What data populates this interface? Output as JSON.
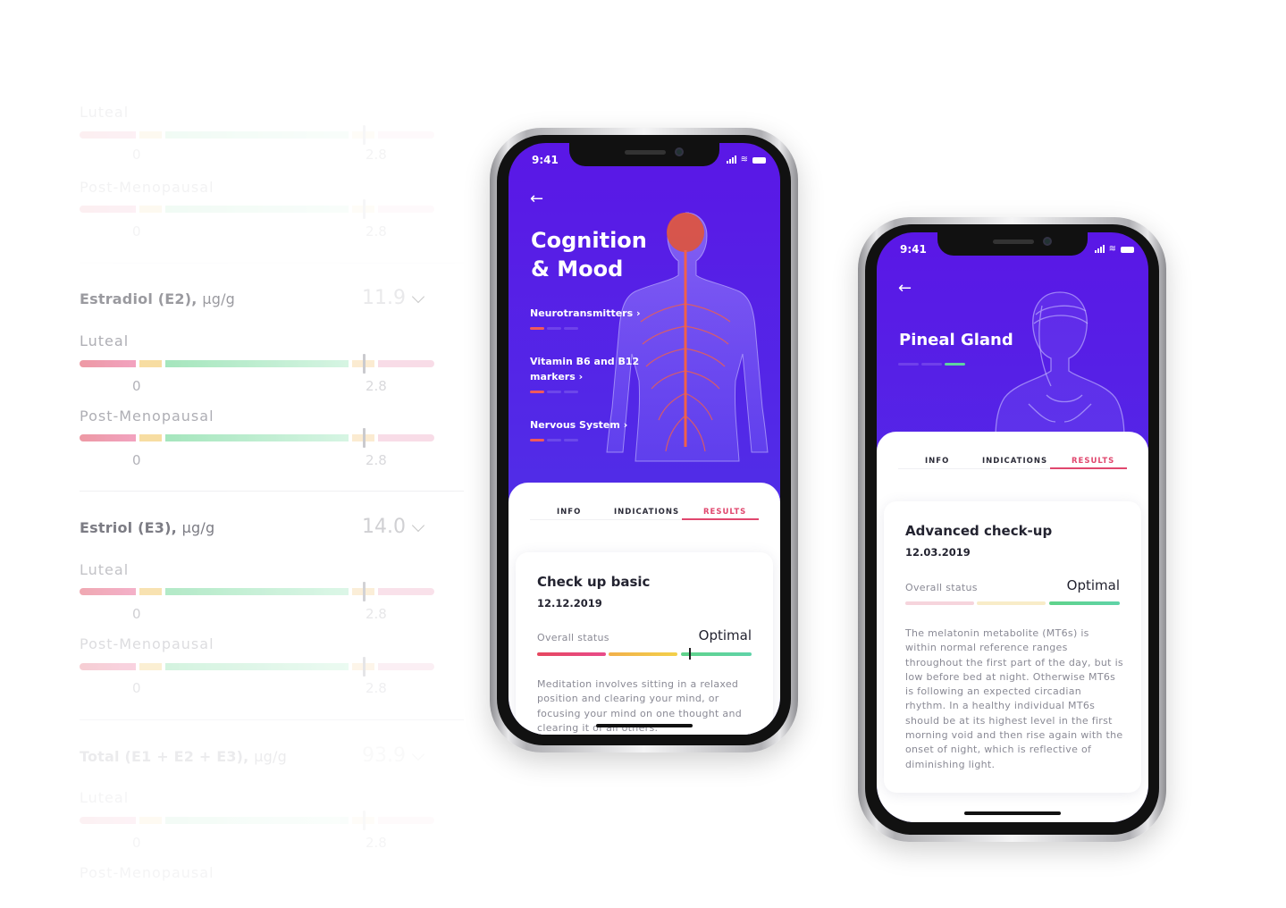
{
  "background_list": {
    "sections": [
      {
        "title": "",
        "value": "",
        "ranges": [
          {
            "label": "Luteal",
            "min": "0",
            "max": "2.8"
          },
          {
            "label": "Post-Menopausal",
            "min": "0",
            "max": "2.8"
          }
        ]
      },
      {
        "title": "Estradiol (E2),",
        "unit": "µg/g",
        "value": "11.9",
        "ranges": [
          {
            "label": "Luteal",
            "min": "0",
            "max": "2.8"
          },
          {
            "label": "Post-Menopausal",
            "min": "0",
            "max": "2.8"
          }
        ]
      },
      {
        "title": "Estriol (E3),",
        "unit": "µg/g",
        "value": "14.0",
        "ranges": [
          {
            "label": "Luteal",
            "min": "0",
            "max": "2.8"
          },
          {
            "label": "Post-Menopausal",
            "min": "0",
            "max": "2.8"
          }
        ]
      },
      {
        "title": "Total (E1 + E2 + E3),",
        "unit": "µg/g",
        "value": "93.9",
        "ranges": [
          {
            "label": "Luteal",
            "min": "0",
            "max": "2.8"
          },
          {
            "label": "Post-Menopausal",
            "min": "",
            "max": ""
          }
        ]
      }
    ]
  },
  "phone1": {
    "time": "9:41",
    "title_line1": "Cognition",
    "title_line2": "& Mood",
    "links": [
      {
        "label": "Neurotransmitters",
        "progress_step": 1
      },
      {
        "label_line1": "Vitamin B6 and B12",
        "label_line2": "markers",
        "progress_step": 1
      },
      {
        "label": "Nervous System",
        "progress_step": 1
      }
    ],
    "tabs": [
      "INFO",
      "INDICATIONS",
      "RESULTS"
    ],
    "active_tab": "RESULTS",
    "card": {
      "title": "Check up basic",
      "date": "12.12.2019",
      "status_label": "Overall status",
      "status_value": "Optimal",
      "status_position_pct": 71,
      "description": "Meditation involves sitting in a relaxed position and clearing your mind, or focusing your mind on one thought and clearing it of all others."
    }
  },
  "phone2": {
    "time": "9:41",
    "title": "Pineal Gland",
    "progress_step": 3,
    "tabs": [
      "INFO",
      "INDICATIONS",
      "RESULTS"
    ],
    "active_tab": "RESULTS",
    "card": {
      "title": "Advanced check-up",
      "date": "12.03.2019",
      "status_label": "Overall status",
      "status_value": "Optimal",
      "description": "The melatonin metabolite (MT6s) is within normal reference ranges throughout the first part of the day, but is low before bed at night. Otherwise MT6s is following an expected circadian rhythm. In a healthy individual MT6s should be at its highest level in the first morning void and then rise again with the onset of night, which is reflective of diminishing light."
    }
  },
  "colors": {
    "purple": "#5a17e6",
    "accent_pink": "#e0476e",
    "red": "#e6475f",
    "yellow": "#f3c34a",
    "green": "#5fd39a"
  }
}
